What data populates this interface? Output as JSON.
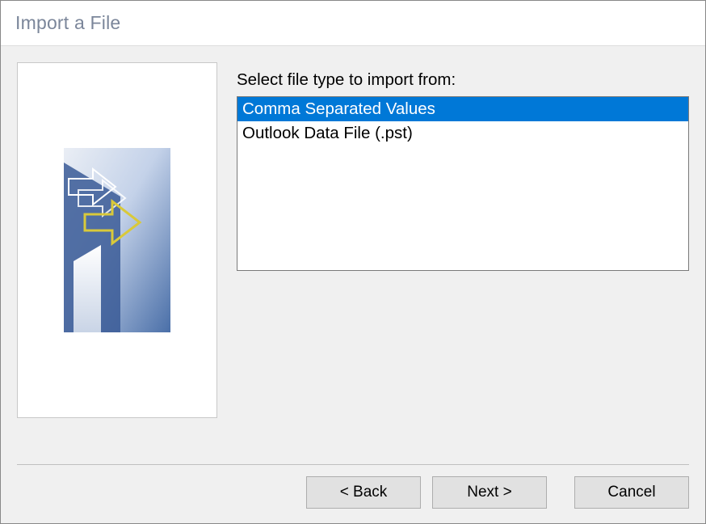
{
  "window": {
    "title": "Import a File"
  },
  "main": {
    "instruction": "Select file type to import from:",
    "file_types": [
      {
        "label": "Comma Separated Values",
        "selected": true
      },
      {
        "label": "Outlook Data File (.pst)",
        "selected": false
      }
    ]
  },
  "buttons": {
    "back": "< Back",
    "next": "Next >",
    "cancel": "Cancel"
  }
}
